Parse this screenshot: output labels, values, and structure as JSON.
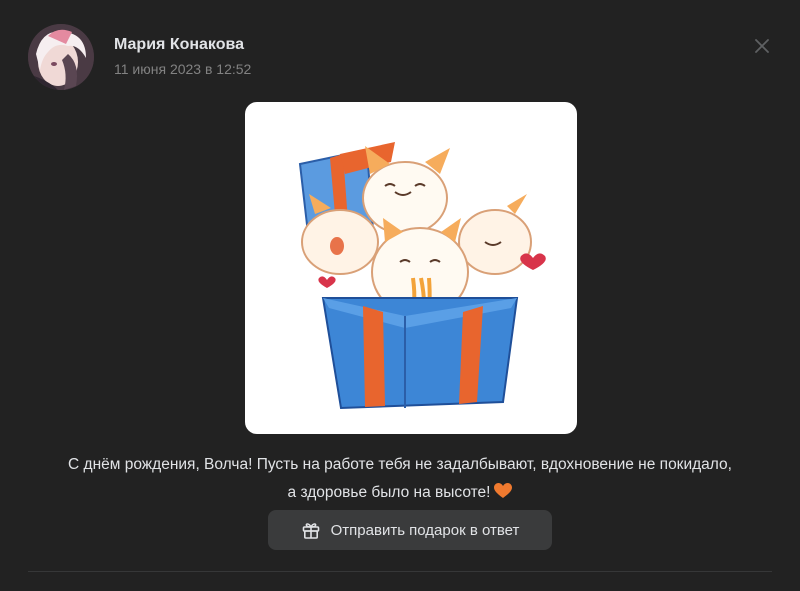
{
  "post": {
    "author": "Мария Конакова",
    "date": "11 июня 2023 в 12:52",
    "message_line1": "С днём рождения, Волча! Пусть на работе тебя не задалбывают, вдохновение не покидало,",
    "message_line2": "а здоровье было на высоте!",
    "message_emoji_icon": "orange-heart-icon"
  },
  "actions": {
    "reply_gift_label": "Отправить подарок в ответ",
    "reply_gift_icon": "gift-icon",
    "close_icon": "close-icon"
  },
  "gift": {
    "image": "gift-box-with-cats",
    "box_color": "#3d86d6",
    "ribbon_color": "#e8652e"
  },
  "colors": {
    "background": "#222222",
    "text_primary": "#e1e3e6",
    "text_secondary": "#828282",
    "button_bg": "#3a3b3c"
  }
}
